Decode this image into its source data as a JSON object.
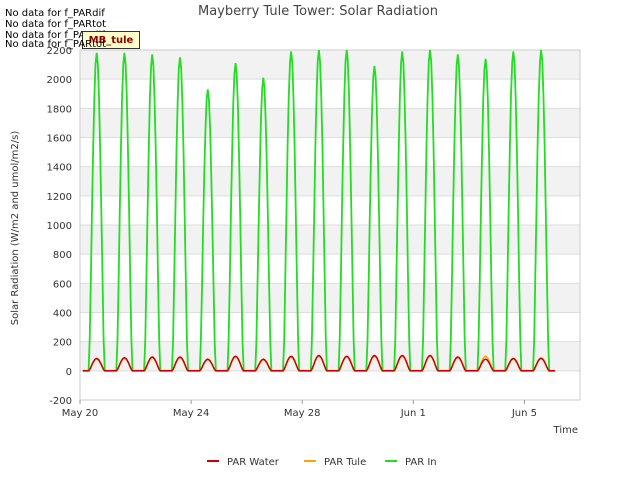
{
  "nodata_messages": [
    "No data for f_PARdif",
    "No data for f_PARtot",
    "No data for f_PARdif",
    "No data for f_PARtot"
  ],
  "site_tag": "MB_tule",
  "chart_data": {
    "type": "line",
    "title": "Mayberry Tule Tower: Solar Radiation",
    "xlabel": "Time",
    "ylabel": "Solar Radiation (W/m2 and umol/m2/s)",
    "ylim": [
      -200,
      2200
    ],
    "yticks": [
      -200,
      0,
      200,
      400,
      600,
      800,
      1000,
      1200,
      1400,
      1600,
      1800,
      2000,
      2200
    ],
    "xlim": [
      "2024-05-20",
      "2024-06-08"
    ],
    "xticks": [
      "May 20",
      "May 24",
      "May 28",
      "Jun 1",
      "Jun 5"
    ],
    "grid": true,
    "legend_position": "bottom",
    "days": [
      "May 20",
      "May 21",
      "May 22",
      "May 23",
      "May 24",
      "May 25",
      "May 26",
      "May 27",
      "May 28",
      "May 29",
      "May 30",
      "May 31",
      "Jun 1",
      "Jun 2",
      "Jun 3",
      "Jun 4",
      "Jun 5"
    ],
    "series": [
      {
        "name": "PAR Water",
        "color": "#cc0000",
        "daily_peak": [
          85,
          90,
          95,
          95,
          80,
          100,
          80,
          100,
          105,
          100,
          105,
          105,
          105,
          95,
          80,
          85,
          85
        ]
      },
      {
        "name": "PAR Tule",
        "color": "#ffa500",
        "daily_peak": [
          80,
          85,
          90,
          90,
          75,
          95,
          75,
          95,
          100,
          95,
          100,
          100,
          100,
          90,
          100,
          80,
          90
        ]
      },
      {
        "name": "PAR In",
        "color": "#22dd22",
        "daily_peak": [
          2180,
          2180,
          2170,
          2150,
          1930,
          2110,
          2010,
          2190,
          2200,
          2200,
          2090,
          2190,
          2200,
          2170,
          2140,
          2190,
          2200
        ]
      }
    ]
  }
}
